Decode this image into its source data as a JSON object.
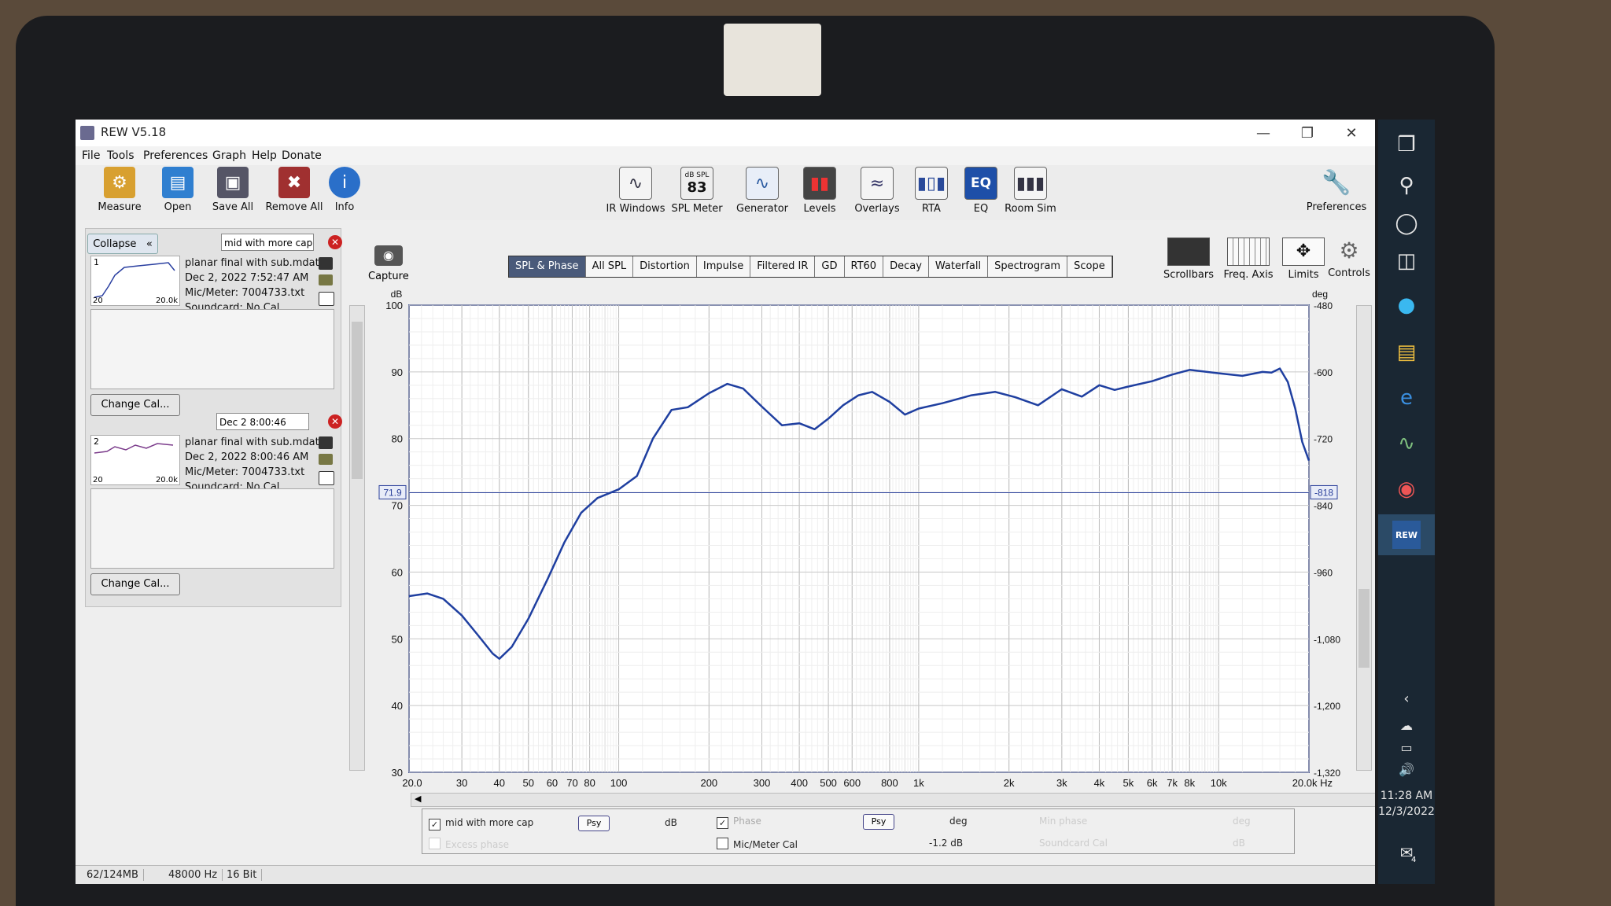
{
  "app": {
    "title": "REW V5.18"
  },
  "menu": [
    "File",
    "Tools",
    "Preferences",
    "Graph",
    "Help",
    "Donate"
  ],
  "toolbar_left": [
    {
      "label": "Measure",
      "icon": "measure-icon",
      "color": "#d8a030"
    },
    {
      "label": "Open",
      "icon": "folder-icon",
      "color": "#2f7fd0"
    },
    {
      "label": "Save All",
      "icon": "save-icon",
      "color": "#555566"
    },
    {
      "label": "Remove All",
      "icon": "remove-icon",
      "color": "#a03030"
    },
    {
      "label": "Info",
      "icon": "info-icon",
      "color": "#2a6fc9"
    }
  ],
  "toolbar_center": [
    {
      "label": "IR Windows",
      "icon": "ir-windows-icon"
    },
    {
      "label": "SPL Meter",
      "icon": "spl-meter-icon",
      "badge_top": "dB SPL",
      "badge_value": "83"
    },
    {
      "label": "Generator",
      "icon": "generator-icon"
    },
    {
      "label": "Levels",
      "icon": "levels-icon"
    },
    {
      "label": "Overlays",
      "icon": "overlays-icon"
    },
    {
      "label": "RTA",
      "icon": "rta-icon"
    },
    {
      "label": "EQ",
      "icon": "eq-icon",
      "badge_value": "EQ"
    },
    {
      "label": "Room Sim",
      "icon": "room-sim-icon"
    }
  ],
  "preferences_label": "Preferences",
  "collapse_label": "Collapse",
  "measurements": [
    {
      "index": "1",
      "name": "mid with more cap",
      "file": "planar final with sub.mdat",
      "date": "Dec 2, 2022 7:52:47 AM",
      "mic": "Mic/Meter: 7004733.txt",
      "soundcard": "Soundcard: No Cal",
      "thumb_lo": "20",
      "thumb_hi": "20.0k",
      "change_cal": "Change Cal..."
    },
    {
      "index": "2",
      "name": "Dec 2 8:00:46",
      "file": "planar final with sub.mdat",
      "date": "Dec 2, 2022 8:00:46 AM",
      "mic": "Mic/Meter: 7004733.txt",
      "soundcard": "Soundcard: No Cal",
      "thumb_lo": "20",
      "thumb_hi": "20.0k",
      "change_cal": "Change Cal..."
    }
  ],
  "capture_label": "Capture",
  "graph_tabs": [
    "SPL & Phase",
    "All SPL",
    "Distortion",
    "Impulse",
    "Filtered IR",
    "GD",
    "RT60",
    "Decay",
    "Waterfall",
    "Spectrogram",
    "Scope"
  ],
  "active_tab": "SPL & Phase",
  "right_tools": [
    "Scrollbars",
    "Freq. Axis",
    "Limits",
    "Controls"
  ],
  "chart_data": {
    "type": "line",
    "left_unit": "dB",
    "right_unit": "deg",
    "ylim": [
      30,
      100
    ],
    "y_ticks": [
      30,
      40,
      50,
      60,
      70,
      80,
      90,
      100
    ],
    "right_ticks": [
      "-480",
      "-600",
      "-720",
      "-840",
      "-960",
      "-1,080",
      "-1,200",
      "-1,320"
    ],
    "x_scale": "log",
    "xlim": [
      20,
      20000
    ],
    "x_ticks": [
      {
        "v": 20,
        "t": "20.0"
      },
      {
        "v": 30,
        "t": "30"
      },
      {
        "v": 40,
        "t": "40"
      },
      {
        "v": 50,
        "t": "50"
      },
      {
        "v": 60,
        "t": "60"
      },
      {
        "v": 70,
        "t": "70"
      },
      {
        "v": 80,
        "t": "80"
      },
      {
        "v": 100,
        "t": "100"
      },
      {
        "v": 200,
        "t": "200"
      },
      {
        "v": 300,
        "t": "300"
      },
      {
        "v": 400,
        "t": "400"
      },
      {
        "v": 500,
        "t": "500"
      },
      {
        "v": 600,
        "t": "600"
      },
      {
        "v": 800,
        "t": "800"
      },
      {
        "v": 1000,
        "t": "1k"
      },
      {
        "v": 2000,
        "t": "2k"
      },
      {
        "v": 3000,
        "t": "3k"
      },
      {
        "v": 4000,
        "t": "4k"
      },
      {
        "v": 5000,
        "t": "5k"
      },
      {
        "v": 6000,
        "t": "6k"
      },
      {
        "v": 7000,
        "t": "7k"
      },
      {
        "v": 8000,
        "t": "8k"
      },
      {
        "v": 10000,
        "t": "10k"
      },
      {
        "v": 20000,
        "t": "20.0k Hz"
      }
    ],
    "cursor_left": "71.9",
    "cursor_right": "-818",
    "cursor_value": 71.9,
    "grid": true,
    "series": [
      {
        "name": "mid with more cap",
        "color": "#1f3fa0",
        "x": [
          20,
          23,
          26,
          30,
          34,
          38,
          40,
          44,
          50,
          58,
          66,
          75,
          85,
          100,
          115,
          130,
          150,
          170,
          200,
          230,
          260,
          300,
          350,
          400,
          450,
          500,
          560,
          630,
          700,
          800,
          900,
          1000,
          1200,
          1500,
          1800,
          2100,
          2500,
          3000,
          3500,
          4000,
          4500,
          5000,
          6000,
          7000,
          8000,
          10000,
          12000,
          14000,
          15000,
          16000,
          17000,
          18000,
          19000,
          20000
        ],
        "y": [
          56.4,
          56.8,
          56.0,
          53.5,
          50.5,
          47.8,
          47.0,
          48.8,
          53.0,
          59.0,
          64.5,
          68.9,
          71.1,
          72.4,
          74.4,
          80.0,
          84.3,
          84.7,
          86.8,
          88.2,
          87.5,
          84.8,
          82.0,
          82.3,
          81.4,
          83.0,
          85.0,
          86.5,
          87.0,
          85.5,
          83.6,
          84.5,
          85.3,
          86.5,
          87.0,
          86.2,
          85.0,
          87.4,
          86.3,
          88.0,
          87.3,
          87.8,
          88.6,
          89.6,
          90.3,
          89.8,
          89.4,
          90.0,
          89.9,
          90.5,
          88.5,
          84.5,
          79.5,
          76.7
        ]
      }
    ]
  },
  "legend": {
    "m_name": "mid with more cap",
    "psy": "Psy",
    "db": "dB",
    "phase": "Phase",
    "deg": "deg",
    "excess_phase": "Excess phase",
    "mic_cal": "Mic/Meter Cal",
    "mic_cal_val": "-1.2 dB",
    "min_phase": "Min phase",
    "soundcard_cal": "Soundcard Cal",
    "db2": "dB",
    "deg2": "deg"
  },
  "status": [
    "62/124MB",
    "48000 Hz",
    "16 Bit"
  ],
  "tray": {
    "time": "11:28 AM",
    "date": "12/3/2022",
    "notif": "4",
    "rew_badge": "REW"
  }
}
